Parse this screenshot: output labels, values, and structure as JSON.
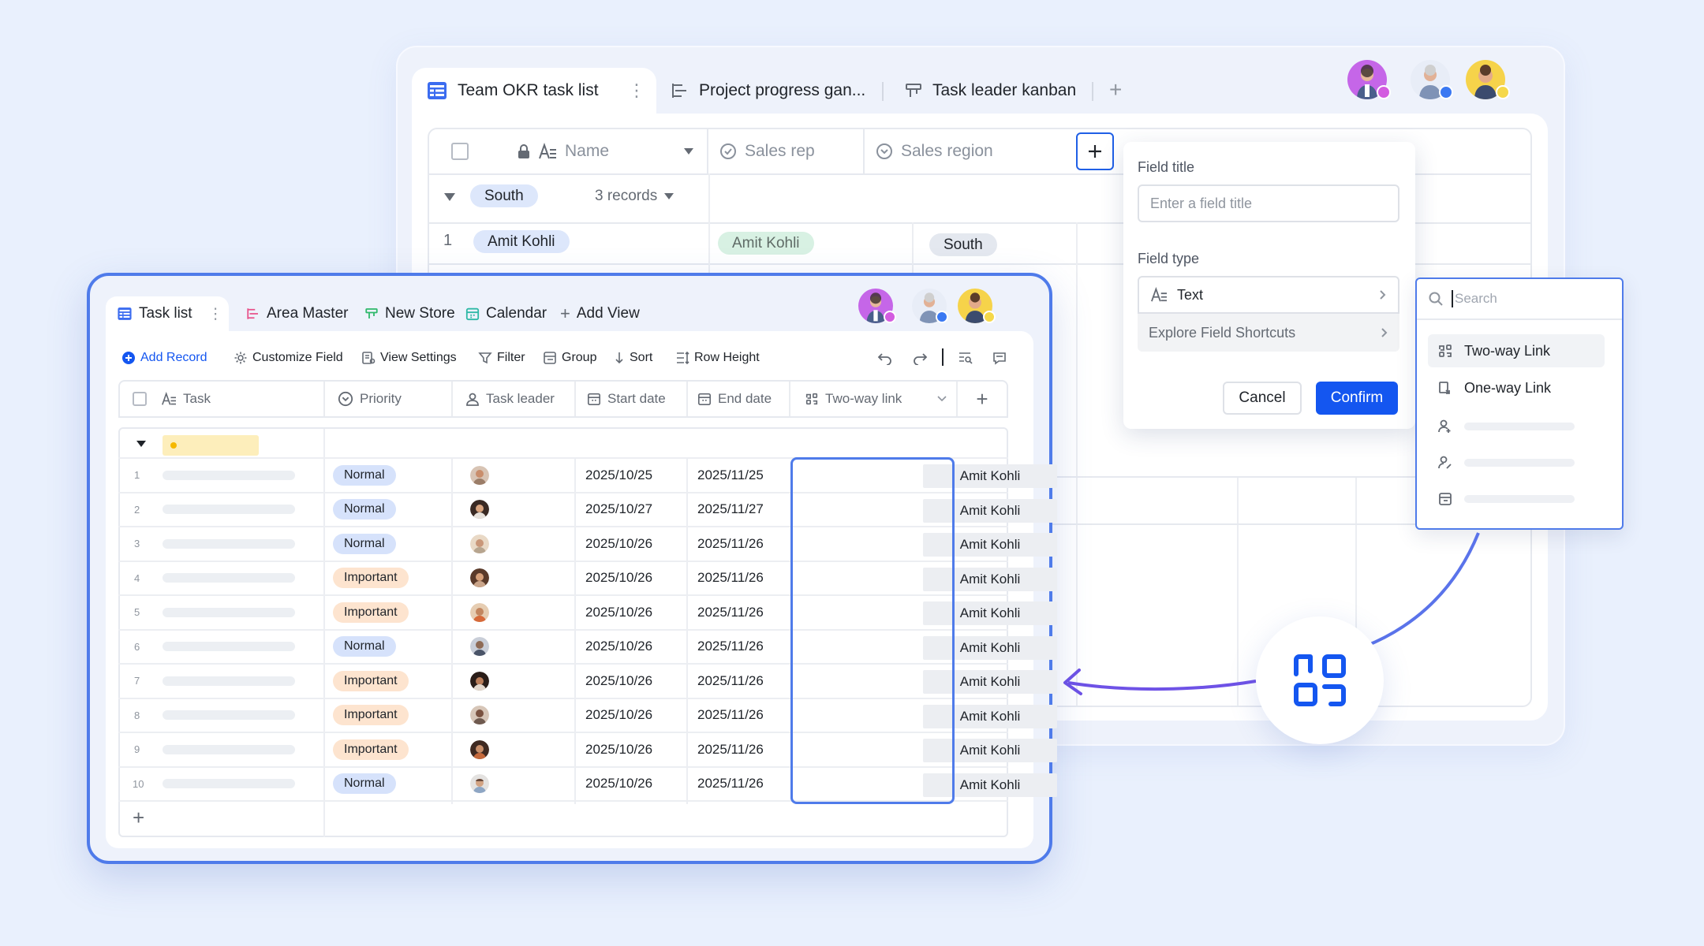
{
  "back_window": {
    "tabs": [
      {
        "label": "Team OKR task list"
      },
      {
        "label": "Project progress gan..."
      },
      {
        "label": "Task leader kanban"
      }
    ],
    "columns": [
      {
        "label": "Name"
      },
      {
        "label": "Sales rep"
      },
      {
        "label": "Sales region"
      }
    ],
    "group": {
      "name": "South",
      "count": "3 records"
    },
    "first_row": {
      "index": "1",
      "name": "Amit Kohli",
      "sales_rep": "Amit Kohli",
      "sales_region": "South"
    }
  },
  "field_panel": {
    "title_label": "Field title",
    "title_placeholder": "Enter a field title",
    "type_label": "Field type",
    "type_value": "Text",
    "shortcuts": "Explore Field Shortcuts",
    "cancel": "Cancel",
    "confirm": "Confirm"
  },
  "search_panel": {
    "placeholder": "Search",
    "items": [
      {
        "label": "Two-way Link"
      },
      {
        "label": "One-way Link"
      }
    ]
  },
  "front_window": {
    "tabs": [
      {
        "label": "Task list"
      },
      {
        "label": "Area Master"
      },
      {
        "label": "New Store"
      },
      {
        "label": "Calendar"
      },
      {
        "label": "Add View"
      }
    ],
    "toolbar": {
      "add_record": "Add Record",
      "customize_field": "Customize Field",
      "view_settings": "View Settings",
      "filter": "Filter",
      "group": "Group",
      "sort": "Sort",
      "row_height": "Row Height"
    },
    "columns": [
      {
        "label": "Task"
      },
      {
        "label": "Priority"
      },
      {
        "label": "Task leader"
      },
      {
        "label": "Start date"
      },
      {
        "label": "End date"
      },
      {
        "label": "Two-way link"
      }
    ],
    "rows": [
      {
        "n": "1",
        "priority": "Normal",
        "start": "2025/10/25",
        "end": "2025/11/25",
        "link": "Amit Kohli"
      },
      {
        "n": "2",
        "priority": "Normal",
        "start": "2025/10/27",
        "end": "2025/11/27",
        "link": "Amit Kohli"
      },
      {
        "n": "3",
        "priority": "Normal",
        "start": "2025/10/26",
        "end": "2025/11/26",
        "link": "Amit Kohli"
      },
      {
        "n": "4",
        "priority": "Important",
        "start": "2025/10/26",
        "end": "2025/11/26",
        "link": "Amit Kohli"
      },
      {
        "n": "5",
        "priority": "Important",
        "start": "2025/10/26",
        "end": "2025/11/26",
        "link": "Amit Kohli"
      },
      {
        "n": "6",
        "priority": "Normal",
        "start": "2025/10/26",
        "end": "2025/11/26",
        "link": "Amit Kohli"
      },
      {
        "n": "7",
        "priority": "Important",
        "start": "2025/10/26",
        "end": "2025/11/26",
        "link": "Amit Kohli"
      },
      {
        "n": "8",
        "priority": "Important",
        "start": "2025/10/26",
        "end": "2025/11/26",
        "link": "Amit Kohli"
      },
      {
        "n": "9",
        "priority": "Important",
        "start": "2025/10/26",
        "end": "2025/11/26",
        "link": "Amit Kohli"
      },
      {
        "n": "10",
        "priority": "Normal",
        "start": "2025/10/26",
        "end": "2025/11/26",
        "link": "Amit Kohli"
      }
    ]
  },
  "colors": {
    "accent": "#1456f0",
    "highlight_border": "#4f7bea",
    "normal_pill": "#d6e2fb",
    "important_pill": "#fde4cf",
    "group_pill": "#dde7fb",
    "sales_rep_pill": "#d8f1e3"
  }
}
